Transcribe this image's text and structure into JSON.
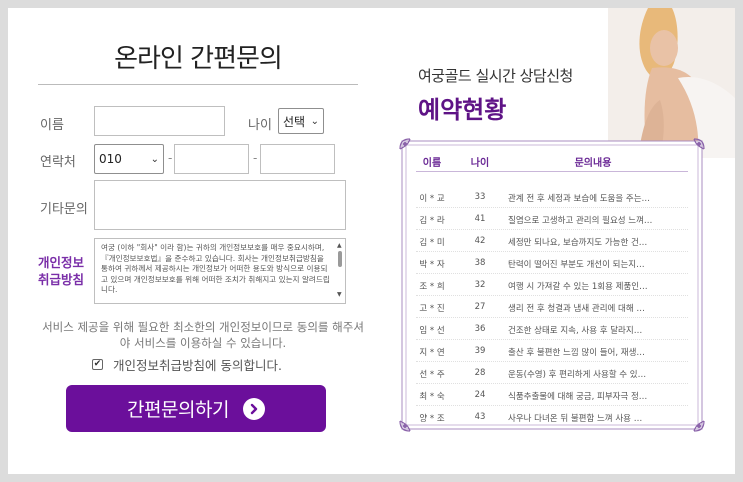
{
  "form": {
    "title": "온라인 간편문의",
    "labels": {
      "name": "이름",
      "age": "나이",
      "contact": "연락처",
      "other": "기타문의",
      "privacy": "개인정보취급방침"
    },
    "age_select": "선택",
    "phone_prefix": "010",
    "dash": "-",
    "privacy_text": "여궁 (이하 \"회사\" 이라 함)는 귀하의 개인정보보호를 매우 중요시하며, 『개인정보보호법』을 준수하고 있습니다. 회사는 개인정보취급방침을 통하여 귀하께서 제공하시는 개인정보가 어떠한 용도와 방식으로 이용되고 있으며 개인정보보호를 위해 어떠한 조치가 취해지고 있는지 알려드립니다.",
    "notice": "서비스 제공을 위해 필요한 최소한의 개인정보이므로 동의를 해주셔야 서비스를 이용하실 수 있습니다.",
    "agree_label": "개인정보취급방침에 동의합니다.",
    "submit_label": "간편문의하기",
    "colors": {
      "accent": "#6b0f9b",
      "privacy_label": "#7a2ea8"
    }
  },
  "panel": {
    "subtitle": "여궁골드 실시간 상담신청",
    "title": "예약현황",
    "headers": {
      "name": "이름",
      "age": "나이",
      "message": "문의내용"
    },
    "rows": [
      {
        "name": "이 * 교",
        "age": "33",
        "message": "관계 전 후 세정과 보습에 도움을 주는…"
      },
      {
        "name": "김 * 라",
        "age": "41",
        "message": "질염으로 고생하고 관리의 필요성 느껴…"
      },
      {
        "name": "김 * 미",
        "age": "42",
        "message": "세정만 되나요, 보습까지도 가능한 건…"
      },
      {
        "name": "박 * 자",
        "age": "38",
        "message": "탄력이 떨어진 부분도 개선이 되는지…"
      },
      {
        "name": "조 * 희",
        "age": "32",
        "message": "여행 시 가져갈 수 있는 1회용 제품인…"
      },
      {
        "name": "고 * 진",
        "age": "27",
        "message": "생리 전 후 청결과 냄새 관리에 대해 …"
      },
      {
        "name": "임 * 선",
        "age": "36",
        "message": "건조한 상태로 지속, 사용 후 달라지…"
      },
      {
        "name": "지 * 연",
        "age": "39",
        "message": "출산 후 불편한 느낌 많이 들어, 재생…"
      },
      {
        "name": "선 * 주",
        "age": "28",
        "message": "운동(수영) 후 편리하게 사용할 수 있…"
      },
      {
        "name": "최 * 숙",
        "age": "24",
        "message": "식품추출물에 대해 궁금, 피부자극 정…"
      },
      {
        "name": "양 * 조",
        "age": "43",
        "message": "사우나 다녀온 뒤 불편함 느껴 사용 …"
      }
    ]
  }
}
